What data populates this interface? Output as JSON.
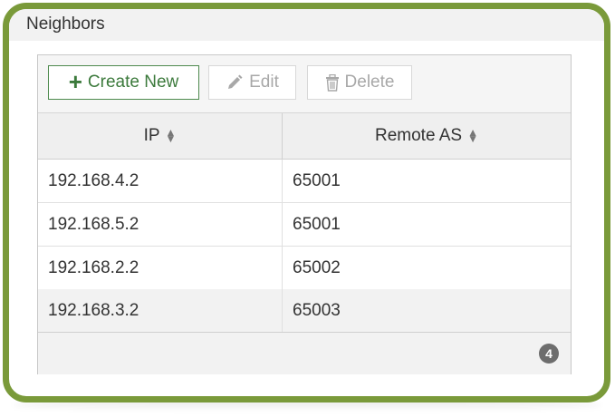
{
  "panel": {
    "title": "Neighbors"
  },
  "toolbar": {
    "create_label": "Create New",
    "edit_label": "Edit",
    "delete_label": "Delete",
    "create_icon": "plus-icon",
    "edit_icon": "pencil-icon",
    "delete_icon": "trash-icon"
  },
  "table": {
    "columns": [
      "IP",
      "Remote AS"
    ],
    "rows": [
      [
        "192.168.4.2",
        "65001"
      ],
      [
        "192.168.5.2",
        "65001"
      ],
      [
        "192.168.2.2",
        "65002"
      ],
      [
        "192.168.3.2",
        "65003"
      ]
    ]
  },
  "footer": {
    "count": "4"
  },
  "colors": {
    "frame": "#7a9a3a",
    "create_button": "#3c7a3c",
    "disabled_text": "#a8a8a8",
    "badge": "#6d6d6d"
  }
}
